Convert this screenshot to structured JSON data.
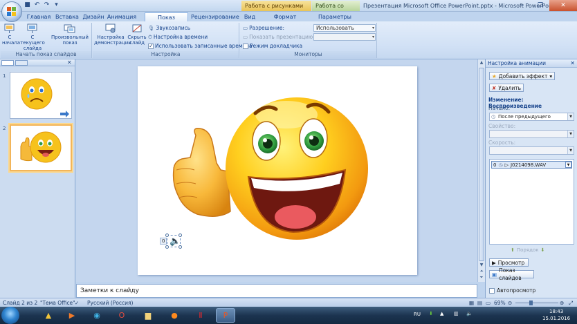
{
  "window": {
    "title": "Презентация Microsoft Office PowerPoint.pptx - Microsoft PowerPoint",
    "context_tabs": [
      "Работа с рисунками",
      "Работа со звуками"
    ]
  },
  "tabs": [
    "Главная",
    "Вставка",
    "Дизайн",
    "Анимация",
    "Показ слайдов",
    "Рецензирование",
    "Вид",
    "Формат",
    "Параметры"
  ],
  "ribbon": {
    "group1": {
      "label": "Начать показ слайдов",
      "buttons": [
        "С начала",
        "С текущего слайда",
        "Произвольный показ"
      ]
    },
    "group2": {
      "label": "Настройка",
      "buttons": [
        "Настройка демонстрации",
        "Скрыть слайд"
      ],
      "items": [
        "Звукозапись",
        "Настройка времени",
        "Использовать записанные времена"
      ]
    },
    "group3": {
      "label": "Мониторы",
      "resolution_label": "Разрешение:",
      "resolution_value": "Использовать текуще...",
      "show_on_label": "Показать презентацию на:",
      "presenter_view": "Режим докладчика"
    }
  },
  "slides": {
    "count": 2,
    "numbers": [
      "1",
      "2"
    ]
  },
  "notes": {
    "placeholder": "Заметки к слайду"
  },
  "sound_object": {
    "order": "0"
  },
  "taskpane": {
    "title": "Настройка анимации",
    "add_effect": "Добавить эффект",
    "remove": "Удалить",
    "change_label": "Изменение: Воспроизведение",
    "start_label": "Начало:",
    "start_value": "После предыдущего",
    "property_label": "Свойство:",
    "speed_label": "Скорость:",
    "anim_item": {
      "order": "0",
      "name": "J0214098.WAV"
    },
    "reorder_label": "Порядок",
    "play_button": "Просмотр",
    "slideshow_button": "Показ слайдов",
    "autopreview": "Автопросмотр"
  },
  "statusbar": {
    "slide_info": "Слайд 2 из 2",
    "theme": "\"Тема Office\"",
    "language": "Русский (Россия)",
    "zoom": "69%"
  },
  "taskbar": {
    "lang": "RU",
    "time": "18:43",
    "date": "15.01.2016"
  }
}
